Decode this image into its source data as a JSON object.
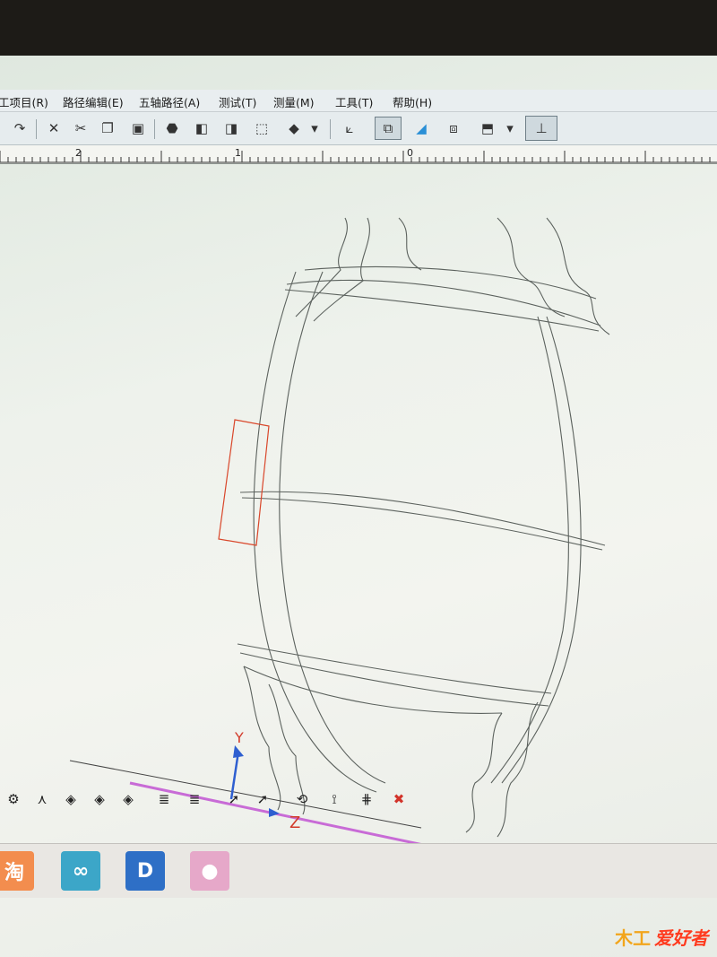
{
  "menubar": {
    "items": [
      "工项目(R)",
      "路径编辑(E)",
      "五轴路径(A)",
      "测试(T)",
      "测量(M)",
      "工具(T)",
      "帮助(H)"
    ]
  },
  "toolbar": {
    "icons": [
      "redo-icon",
      "delete-icon",
      "cut-icon",
      "copy-icon",
      "paste-icon",
      "solid-box-icon",
      "box-front-icon",
      "box-side-icon",
      "wireframe-box-icon",
      "view-plane-icon",
      "axis-view-icon",
      "view-cube-active-icon",
      "shaded-box-icon",
      "box-outline-icon",
      "iso-box-icon",
      "coordinate-axes-icon"
    ]
  },
  "ruler": {
    "labels": [
      "2",
      "1",
      "0"
    ]
  },
  "viewport": {
    "axis_y_label": "Y",
    "axis_z_label": "Z",
    "colors": {
      "wire": "#5c625e",
      "selection": "#d9472b",
      "axis_y": "#2e5fd0",
      "axis_z": "#d23b2b",
      "ground": "#c86bd6"
    }
  },
  "bottom_toolbar": {
    "icons": [
      "gear-icon",
      "fork-icon",
      "diamond-icon",
      "diamond-icon",
      "diamond-icon",
      "layers-icon",
      "layers-icon",
      "cursor-x-icon",
      "cursor-x-icon",
      "rotate-diamond-icon",
      "tool-path-icon",
      "tool-path-icon",
      "close-icon"
    ]
  },
  "taskbar": {
    "apps": [
      {
        "name": "taobao",
        "glyph": "淘",
        "color": "#f38d4e"
      },
      {
        "name": "app-rings",
        "glyph": "∞",
        "color": "#3ca6c8"
      },
      {
        "name": "app-d",
        "glyph": "D",
        "color": "#2e6fc6"
      },
      {
        "name": "app-pink",
        "glyph": "●",
        "color": "#e6a8c9"
      }
    ]
  },
  "watermark": {
    "mark": "木工",
    "text": "爱好者"
  }
}
